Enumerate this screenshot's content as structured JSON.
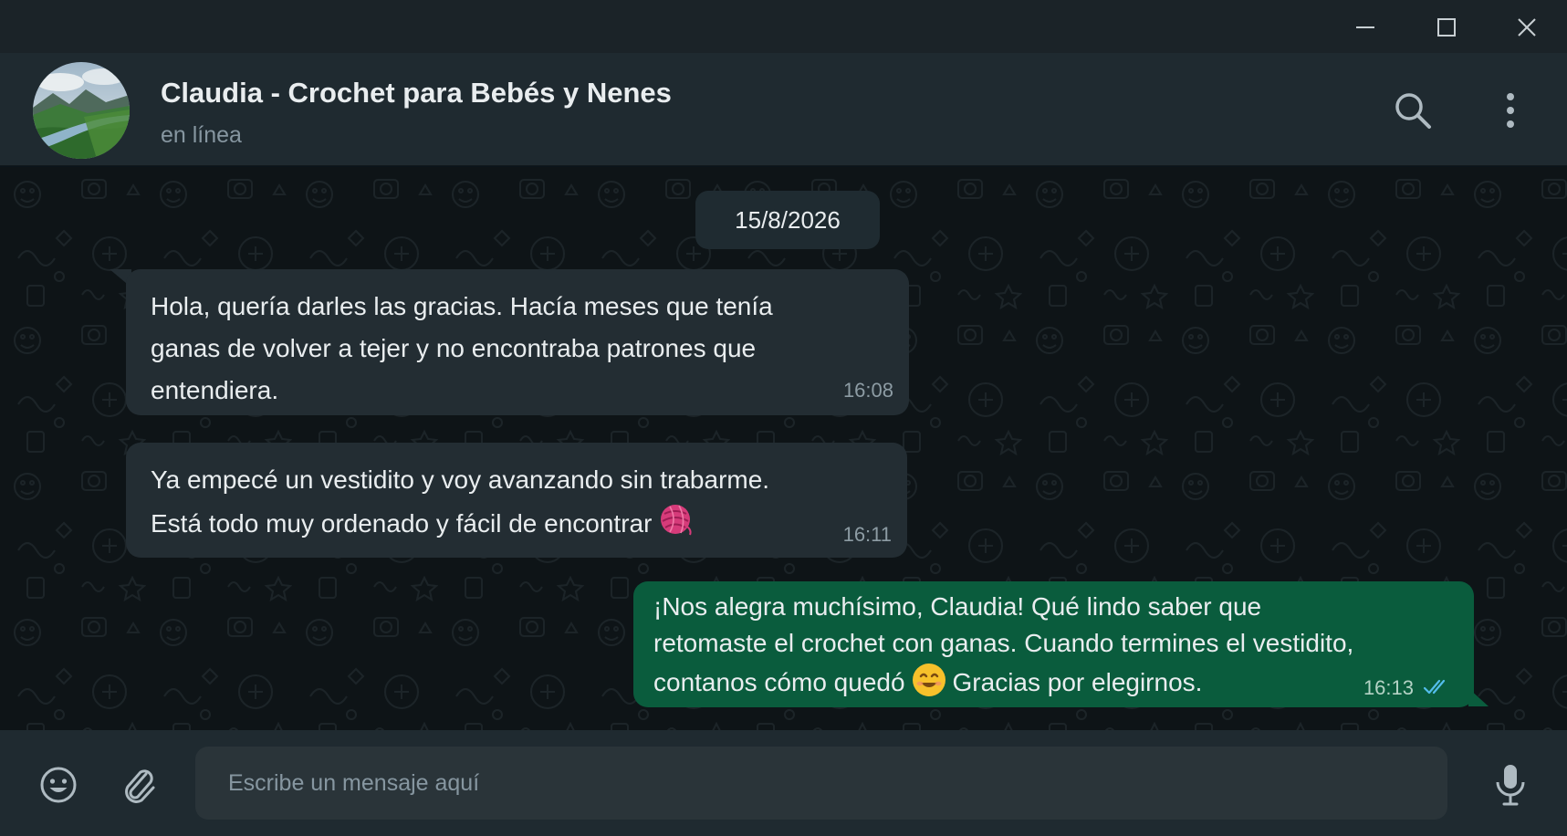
{
  "window": {
    "controls": [
      {
        "name": "minimize-icon"
      },
      {
        "name": "maximize-icon"
      },
      {
        "name": "close-icon"
      }
    ]
  },
  "header": {
    "contact_name": "Claudia - Crochet para Bebés y Nenes",
    "status": "en línea",
    "avatar_icon": "landscape-avatar",
    "actions": [
      "search-icon",
      "more-options-icon"
    ]
  },
  "chat": {
    "date": "15/8/2026",
    "messages": [
      {
        "direction": "incoming",
        "lines": [
          "Hola, quería darles las gracias. Hacía meses que tenía",
          "ganas de volver a tejer y no encontraba patrones que",
          "entendiera."
        ],
        "time": "16:08"
      },
      {
        "direction": "incoming",
        "lines": [
          "Ya empecé un vestidito y voy avanzando sin trabarme.",
          "Está todo muy ordenado y fácil de encontrar"
        ],
        "emoji": "yarn-ball",
        "time": "16:11"
      },
      {
        "direction": "outgoing",
        "lines": [
          "¡Nos alegra muchísimo, Claudia! Qué lindo saber que",
          "retomaste el crochet con ganas. Cuando termines el vestidito,",
          "contanos cómo quedó",
          "Gracias por elegirnos."
        ],
        "emoji": "smiling-face",
        "time": "16:13",
        "read_status": "double-check-read"
      }
    ]
  },
  "composer": {
    "placeholder": "Escribe un mensaje aquí",
    "value": "",
    "icons": [
      "emoji-icon",
      "attach-icon",
      "microphone-icon"
    ]
  },
  "colors": {
    "incoming_bubble": "#232d33",
    "outgoing_bubble": "#0a5c3d",
    "header_bg": "#1f2a30",
    "read_tick": "#53bdeb"
  }
}
